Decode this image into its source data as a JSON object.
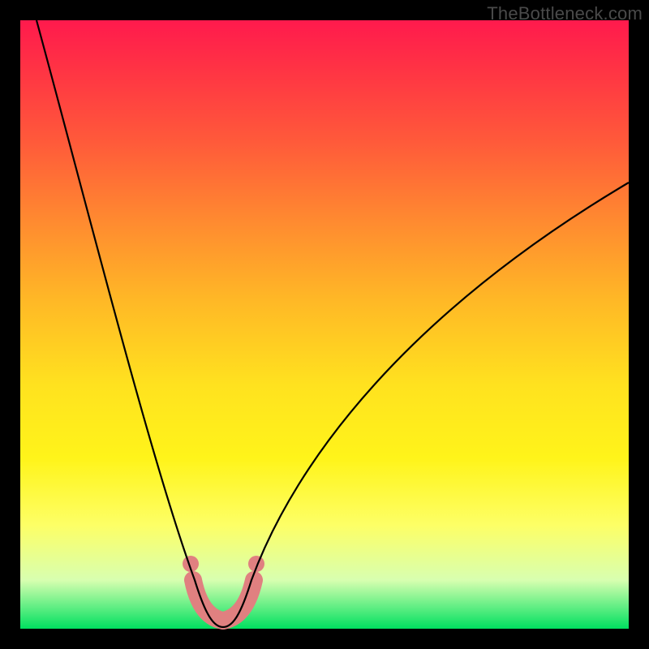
{
  "watermark": "TheBottleneck.com",
  "chart_data": {
    "type": "line",
    "title": "",
    "xlabel": "",
    "ylabel": "",
    "xlim": [
      0,
      100
    ],
    "ylim": [
      0,
      100
    ],
    "series": [
      {
        "name": "bottleneck-curve",
        "x": [
          3,
          8,
          14,
          20,
          25,
          28,
          30,
          32,
          34,
          36,
          40,
          46,
          54,
          64,
          78,
          100
        ],
        "y": [
          100,
          82,
          62,
          42,
          24,
          14,
          6,
          1,
          0,
          1,
          6,
          16,
          30,
          46,
          62,
          74
        ]
      }
    ],
    "highlight_region": {
      "name": "optimal-range",
      "x": [
        28,
        30,
        32,
        34,
        36,
        38
      ],
      "y": [
        8,
        3,
        1,
        1,
        3,
        8
      ]
    },
    "gradient_stops": [
      {
        "pos": 0,
        "color": "#ff1a4d"
      },
      {
        "pos": 20,
        "color": "#ff5a3a"
      },
      {
        "pos": 46,
        "color": "#ffb826"
      },
      {
        "pos": 72,
        "color": "#fff41a"
      },
      {
        "pos": 92,
        "color": "#d8ffb0"
      },
      {
        "pos": 100,
        "color": "#00e060"
      }
    ]
  }
}
